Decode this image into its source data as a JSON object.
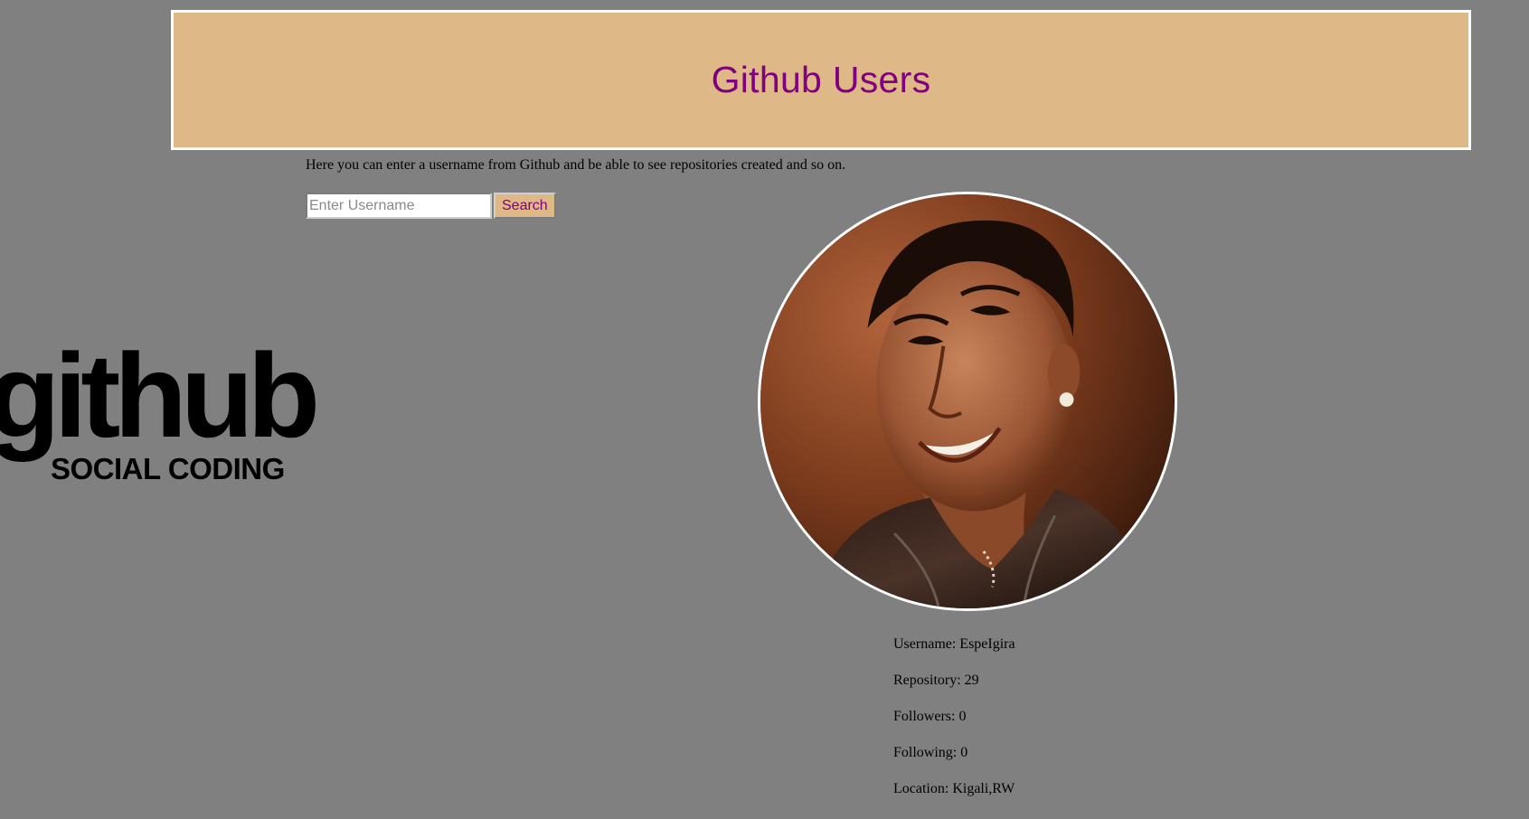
{
  "header": {
    "title": "Github Users"
  },
  "intro": {
    "text": "Here you can enter a username from Github and be able to see repositories created and so on."
  },
  "search": {
    "placeholder": "Enter Username",
    "value": "",
    "button_label": "Search"
  },
  "logo": {
    "word": "github",
    "tagline": "SOCIAL CODING"
  },
  "colors": {
    "page_background": "#808080",
    "header_background": "#deb887",
    "accent": "#800080",
    "border": "#ffffff"
  },
  "profile": {
    "avatar_icon": "user-avatar-photo",
    "username": "Username: EspeIgira",
    "repository": "Repository: 29",
    "followers": "Followers: 0",
    "following": "Following: 0",
    "location": "Location: Kigali,RW"
  }
}
